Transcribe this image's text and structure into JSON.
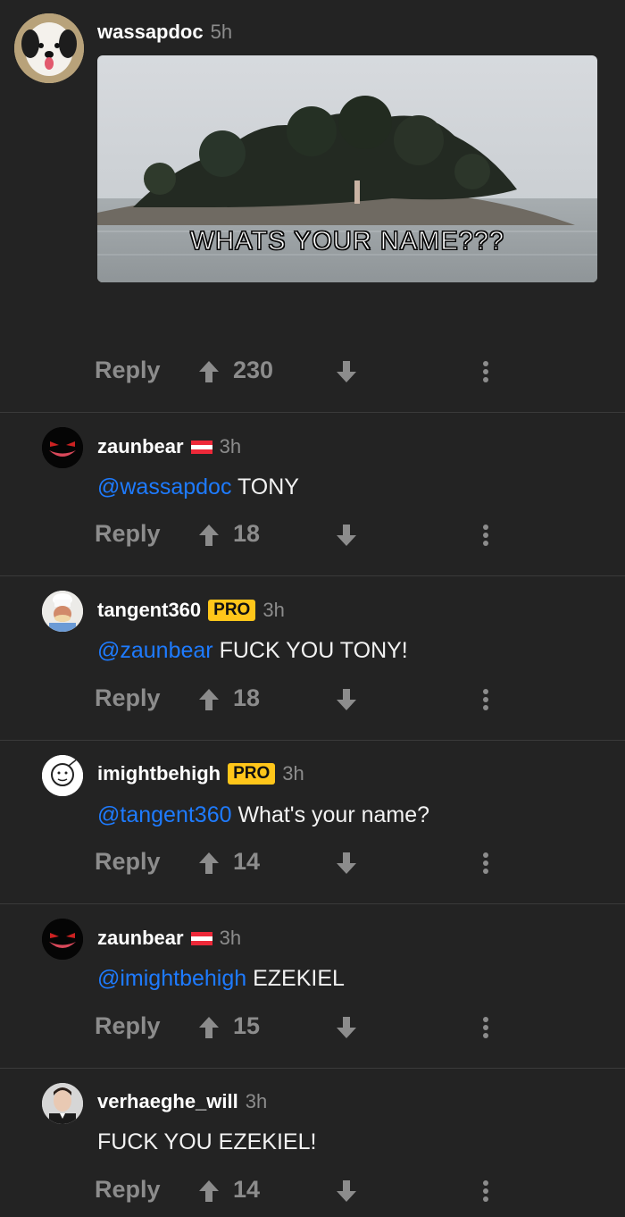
{
  "actions": {
    "reply_label": "Reply"
  },
  "comments": [
    {
      "username": "wassapdoc",
      "time": "5h",
      "badge": "",
      "flag": false,
      "mention": "",
      "text": "",
      "votes": "230",
      "image_caption": "WHATS YOUR NAME???"
    },
    {
      "username": "zaunbear",
      "time": "3h",
      "badge": "",
      "flag": true,
      "mention": "@wassapdoc",
      "text": " TONY",
      "votes": "18"
    },
    {
      "username": "tangent360",
      "time": "3h",
      "badge": "PRO",
      "flag": false,
      "mention": "@zaunbear",
      "text": " FUCK YOU TONY!",
      "votes": "18"
    },
    {
      "username": "imightbehigh",
      "time": "3h",
      "badge": "PRO",
      "flag": false,
      "mention": "@tangent360",
      "text": " What's your name?",
      "votes": "14"
    },
    {
      "username": "zaunbear",
      "time": "3h",
      "badge": "",
      "flag": true,
      "mention": "@imightbehigh",
      "text": " EZEKIEL",
      "votes": "15"
    },
    {
      "username": "verhaeghe_will",
      "time": "3h",
      "badge": "",
      "flag": false,
      "mention": "",
      "text": "FUCK YOU EZEKIEL!",
      "votes": "14"
    }
  ],
  "colors": {
    "background": "#232323",
    "mention": "#1e7bff",
    "pro_badge": "#ffc61a",
    "muted": "#8c8c8c"
  },
  "icons": [
    "upvote-icon",
    "downvote-icon",
    "more-options-icon",
    "austria-flag-icon"
  ]
}
